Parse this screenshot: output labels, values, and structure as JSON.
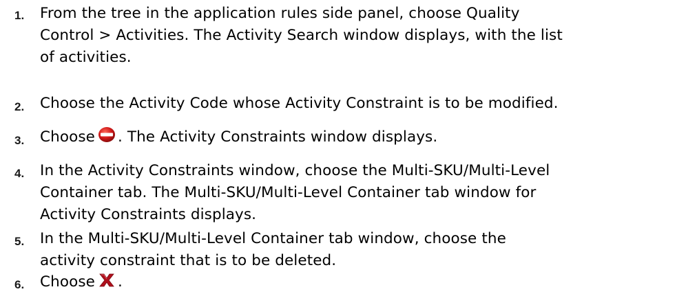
{
  "steps": [
    {
      "number": "1.",
      "lines": [
        "From the tree in the application rules side panel, choose Quality",
        "Control > Activities. The Activity Search window displays, with the list",
        "of activities."
      ]
    },
    {
      "number": "2.",
      "lines": [
        "Choose the Activity Code whose Activity Constraint is to be modified."
      ]
    },
    {
      "number": "3.",
      "before_icon": "Choose",
      "icon": "delete-circle-icon",
      "after_icon": ". The Activity Constraints window displays."
    },
    {
      "number": "4.",
      "lines": [
        "In the Activity Constraints window, choose the Multi-SKU/Multi-Level",
        "Container tab. The Multi-SKU/Multi-Level Container tab window for",
        "Activity Constraints displays."
      ]
    },
    {
      "number": "5.",
      "lines": [
        "In the Multi-SKU/Multi-Level Container tab window, choose the",
        "activity constraint that is to be deleted."
      ]
    },
    {
      "number": "6.",
      "before_icon": "Choose",
      "icon": "delete-x-icon",
      "after_icon": "."
    }
  ],
  "colors": {
    "text": "#000000",
    "number": "#1a1a1a",
    "delete_circle": "#d01818",
    "delete_x": "#b0101c"
  }
}
